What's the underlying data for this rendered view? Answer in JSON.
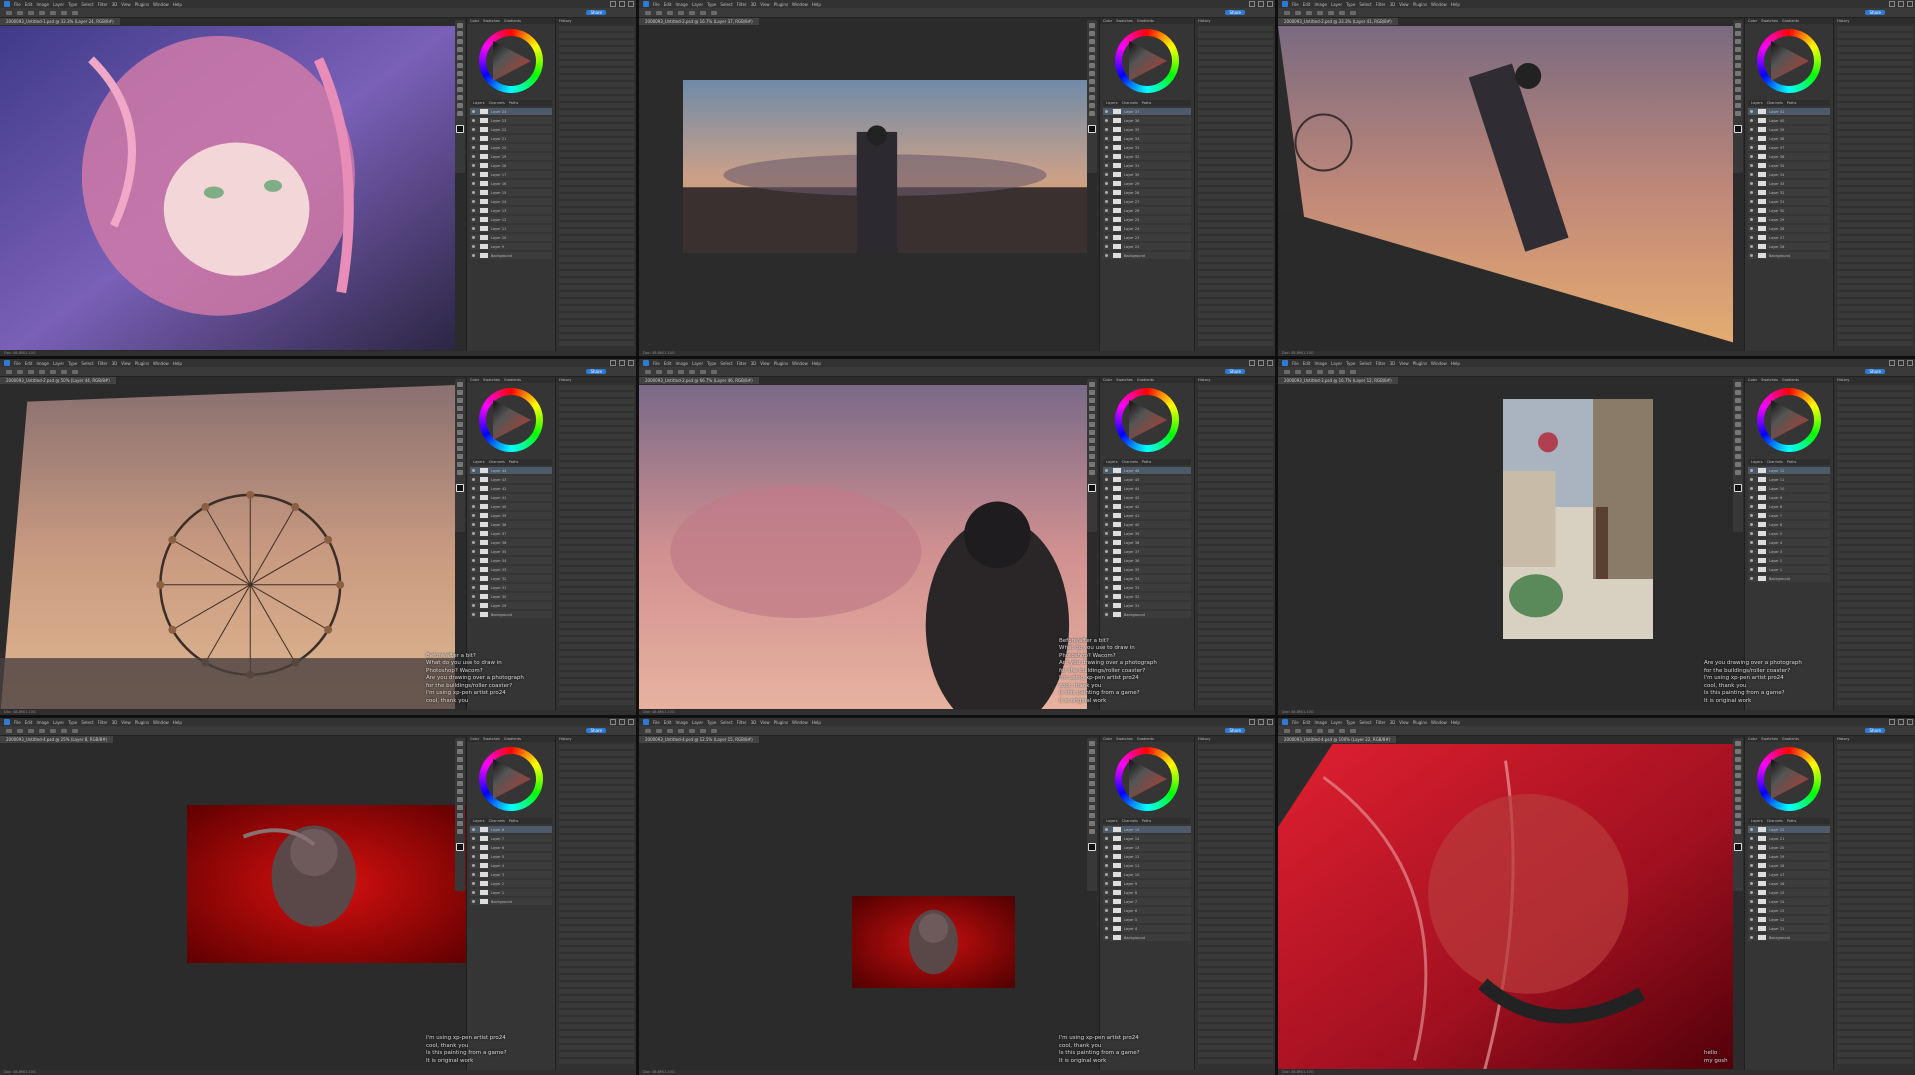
{
  "app": {
    "menu": [
      "File",
      "Edit",
      "Image",
      "Layer",
      "Type",
      "Select",
      "Filter",
      "3D",
      "View",
      "Plugins",
      "Window",
      "Help"
    ],
    "share_label": "Share",
    "status_text": "Doc: 48.8M/1.10G"
  },
  "panels": {
    "panel_tabs": [
      "Color",
      "Swatches",
      "Gradients"
    ],
    "layers_tabs": [
      "Layers",
      "Channels",
      "Paths"
    ],
    "history_tab": "History"
  },
  "windows": [
    {
      "doc_title": "2000093_Untitled-1.psd @ 33.3% (Layer 24, RGB/8#)",
      "layers": [
        "Layer 24",
        "Layer 23",
        "Layer 22",
        "Layer 21",
        "Layer 20",
        "Layer 19",
        "Layer 18",
        "Layer 17",
        "Layer 16",
        "Layer 15",
        "Layer 14",
        "Layer 13",
        "Layer 12",
        "Layer 11",
        "Layer 10",
        "Layer 9",
        "Background"
      ],
      "chat": []
    },
    {
      "doc_title": "2000093_Untitled-2.psd @ 16.7% (Layer 37, RGB/8#)",
      "layers": [
        "Layer 37",
        "Layer 36",
        "Layer 35",
        "Layer 34",
        "Layer 33",
        "Layer 32",
        "Layer 31",
        "Layer 30",
        "Layer 29",
        "Layer 28",
        "Layer 27",
        "Layer 26",
        "Layer 25",
        "Layer 24",
        "Layer 23",
        "Layer 22",
        "Background"
      ],
      "chat": []
    },
    {
      "doc_title": "2000093_Untitled-2.psd @ 33.3% (Layer 41, RGB/8#)",
      "layers": [
        "Layer 41",
        "Layer 40",
        "Layer 39",
        "Layer 38",
        "Layer 37",
        "Layer 36",
        "Layer 35",
        "Layer 34",
        "Layer 33",
        "Layer 32",
        "Layer 31",
        "Layer 30",
        "Layer 29",
        "Layer 28",
        "Layer 27",
        "Layer 26",
        "Background"
      ],
      "chat": []
    },
    {
      "doc_title": "2000093_Untitled-2.psd @ 50% (Layer 44, RGB/8#)",
      "layers": [
        "Layer 44",
        "Layer 43",
        "Layer 42",
        "Layer 41",
        "Layer 40",
        "Layer 39",
        "Layer 38",
        "Layer 37",
        "Layer 36",
        "Layer 35",
        "Layer 34",
        "Layer 33",
        "Layer 32",
        "Layer 31",
        "Layer 30",
        "Layer 29",
        "Background"
      ],
      "chat": [
        {
          "user": "",
          "text": "Before/after a bit?"
        },
        {
          "user": "",
          "text": "What do you use to draw in"
        },
        {
          "user": "",
          "text": "Photoshop? Wacom?"
        },
        {
          "user": "",
          "text": "Are you drawing over a photograph"
        },
        {
          "user": "",
          "text": "for the buildings/roller coaster?"
        },
        {
          "user": "",
          "text": "I'm using xp-pen artist pro24"
        },
        {
          "user": "",
          "text": "cool, thank you"
        }
      ]
    },
    {
      "doc_title": "2000093_Untitled-2.psd @ 66.7% (Layer 46, RGB/8#)",
      "layers": [
        "Layer 46",
        "Layer 45",
        "Layer 44",
        "Layer 43",
        "Layer 42",
        "Layer 41",
        "Layer 40",
        "Layer 39",
        "Layer 38",
        "Layer 37",
        "Layer 36",
        "Layer 35",
        "Layer 34",
        "Layer 33",
        "Layer 32",
        "Layer 31",
        "Background"
      ],
      "chat": [
        {
          "user": "",
          "text": "Before/after a bit?"
        },
        {
          "user": "",
          "text": "What do you use to draw in"
        },
        {
          "user": "",
          "text": "Photoshop? Wacom?"
        },
        {
          "user": "",
          "text": "Are you drawing over a photograph"
        },
        {
          "user": "",
          "text": "for the buildings/roller coaster?"
        },
        {
          "user": "",
          "text": "I'm using xp-pen artist pro24"
        },
        {
          "user": "",
          "text": "cool, thank you"
        },
        {
          "user": "",
          "text": "Is this painting from a game?"
        },
        {
          "user": "",
          "text": "It is original work"
        }
      ]
    },
    {
      "doc_title": "2000093_Untitled-3.psd @ 16.7% (Layer 12, RGB/8#)",
      "layers": [
        "Layer 12",
        "Layer 11",
        "Layer 10",
        "Layer 9",
        "Layer 8",
        "Layer 7",
        "Layer 6",
        "Layer 5",
        "Layer 4",
        "Layer 3",
        "Layer 2",
        "Layer 1",
        "Background"
      ],
      "chat": [
        {
          "user": "",
          "text": "Are you drawing over a photograph"
        },
        {
          "user": "",
          "text": "for the buildings/roller coaster?"
        },
        {
          "user": "",
          "text": "I'm using xp-pen artist pro24"
        },
        {
          "user": "",
          "text": "cool, thank you"
        },
        {
          "user": "",
          "text": "Is this painting from a game?"
        },
        {
          "user": "",
          "text": "It is original work"
        }
      ]
    },
    {
      "doc_title": "2000093_Untitled-4.psd @ 25% (Layer 8, RGB/8#)",
      "layers": [
        "Layer 8",
        "Layer 7",
        "Layer 6",
        "Layer 5",
        "Layer 4",
        "Layer 3",
        "Layer 2",
        "Layer 1",
        "Background"
      ],
      "chat": [
        {
          "user": "",
          "text": "I'm using xp-pen artist pro24"
        },
        {
          "user": "",
          "text": "cool, thank you"
        },
        {
          "user": "",
          "text": "Is this painting from a game?"
        },
        {
          "user": "",
          "text": "It is original work"
        }
      ]
    },
    {
      "doc_title": "2000093_Untitled-4.psd @ 12.5% (Layer 15, RGB/8#)",
      "layers": [
        "Layer 15",
        "Layer 14",
        "Layer 13",
        "Layer 12",
        "Layer 11",
        "Layer 10",
        "Layer 9",
        "Layer 8",
        "Layer 7",
        "Layer 6",
        "Layer 5",
        "Layer 4",
        "Background"
      ],
      "chat": [
        {
          "user": "",
          "text": "I'm using xp-pen artist pro24"
        },
        {
          "user": "",
          "text": "cool, thank you"
        },
        {
          "user": "",
          "text": "Is this painting from a game?"
        },
        {
          "user": "",
          "text": "It is original work"
        }
      ]
    },
    {
      "doc_title": "2000093_Untitled-4.psd @ 100% (Layer 22, RGB/8#)",
      "layers": [
        "Layer 22",
        "Layer 21",
        "Layer 20",
        "Layer 19",
        "Layer 18",
        "Layer 17",
        "Layer 16",
        "Layer 15",
        "Layer 14",
        "Layer 13",
        "Layer 12",
        "Layer 11",
        "Background"
      ],
      "chat": [
        {
          "user": "",
          "text": "hello"
        },
        {
          "user": "",
          "text": "my gosh"
        }
      ]
    }
  ],
  "colors": {
    "app_bg": "#2b2b2b",
    "panel_bg": "#353535",
    "accent": "#2d7bd6",
    "selected_layer": "#4d5a6a"
  }
}
